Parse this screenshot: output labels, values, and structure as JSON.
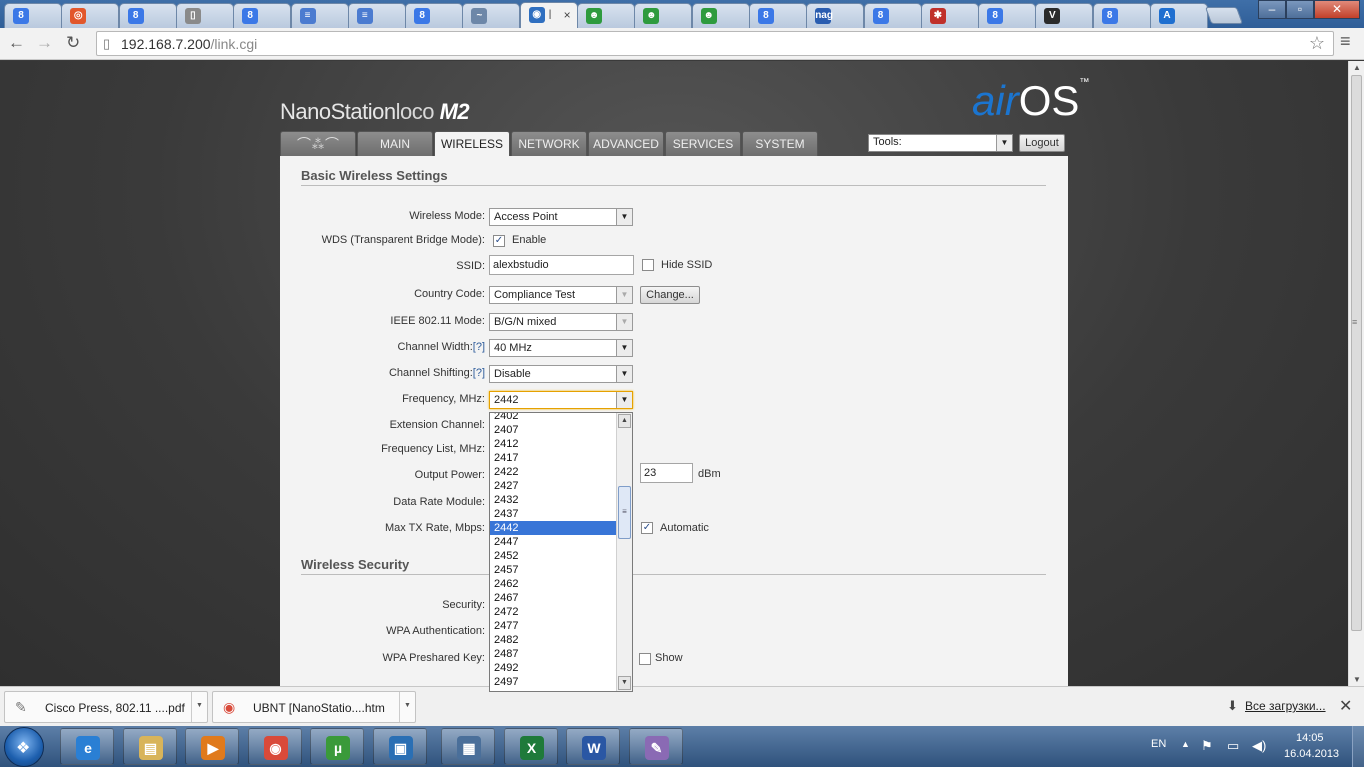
{
  "browser": {
    "tabs": [
      {
        "icon": "google-icon",
        "text": "8",
        "title": "",
        "color": "#3b78e7"
      },
      {
        "icon": "ubuntu-icon",
        "text": "◎",
        "title": "",
        "color": "#e2572b"
      },
      {
        "icon": "google-icon",
        "text": "8",
        "title": "",
        "color": "#3b78e7"
      },
      {
        "icon": "page-icon",
        "text": "▯",
        "title": "",
        "color": "#8a8a8a"
      },
      {
        "icon": "google-icon",
        "text": "8",
        "title": "",
        "color": "#3b78e7"
      },
      {
        "icon": "doc-icon",
        "text": "≡",
        "title": "",
        "color": "#4b7bd0"
      },
      {
        "icon": "doc-icon",
        "text": "≡",
        "title": "",
        "color": "#4b7bd0"
      },
      {
        "icon": "google-icon",
        "text": "8",
        "title": "",
        "color": "#3b78e7"
      },
      {
        "icon": "chart-icon",
        "text": "~",
        "title": "",
        "color": "#6d87a8"
      },
      {
        "icon": "rss-icon",
        "text": "◉",
        "title": "|",
        "color": "#2f6fc0"
      },
      {
        "icon": "frog-icon",
        "text": "☻",
        "title": "",
        "color": "#2e9b3e"
      },
      {
        "icon": "frog-icon",
        "text": "☻",
        "title": "",
        "color": "#2e9b3e"
      },
      {
        "icon": "frog-icon",
        "text": "☻",
        "title": "",
        "color": "#2e9b3e"
      },
      {
        "icon": "google-icon",
        "text": "8",
        "title": "",
        "color": "#3b78e7"
      },
      {
        "icon": "nag-icon",
        "text": "nag",
        "title": "",
        "color": "#2a5db0"
      },
      {
        "icon": "google-icon",
        "text": "8",
        "title": "",
        "color": "#3b78e7"
      },
      {
        "icon": "bug-icon",
        "text": "✱",
        "title": "",
        "color": "#c0302a"
      },
      {
        "icon": "google-icon",
        "text": "8",
        "title": "",
        "color": "#3b78e7"
      },
      {
        "icon": "v-icon",
        "text": "V",
        "title": "",
        "color": "#2b2b2b"
      },
      {
        "icon": "google-icon",
        "text": "8",
        "title": "",
        "color": "#3b78e7"
      },
      {
        "icon": "a-icon",
        "text": "A",
        "title": "",
        "color": "#1f6fd0"
      }
    ],
    "active_tab_close": "×",
    "url_host": "192.168.7.200",
    "url_path": "/link.cgi"
  },
  "page": {
    "brand_model": "NanoStation",
    "brand_loco": "loco",
    "brand_m2": "M2",
    "brand_air": "air",
    "brand_os": "OS",
    "brand_tm": "™",
    "nav_tabs": [
      "MAIN",
      "WIRELESS",
      "NETWORK",
      "ADVANCED",
      "SERVICES",
      "SYSTEM"
    ],
    "tools_label": "Tools:",
    "logout_label": "Logout",
    "basic_title": "Basic Wireless Settings",
    "fields": {
      "wireless_mode_label": "Wireless Mode:",
      "wireless_mode_value": "Access Point",
      "wds_label": "WDS (Transparent Bridge Mode):",
      "wds_enable_label": "Enable",
      "ssid_label": "SSID:",
      "ssid_value": "alexbstudio",
      "hide_ssid_label": "Hide SSID",
      "country_label": "Country Code:",
      "country_value": "Compliance Test",
      "change_button": "Change...",
      "ieee_label": "IEEE 802.11 Mode:",
      "ieee_value": "B/G/N mixed",
      "channel_width_label": "Channel Width:",
      "channel_width_value": "40 MHz",
      "channel_shift_label": "Channel Shifting:",
      "channel_shift_value": "Disable",
      "help": "[?]",
      "frequency_label": "Frequency, MHz:",
      "frequency_value": "2442",
      "ext_channel_label": "Extension Channel:",
      "freq_list_label": "Frequency List, MHz:",
      "output_power_label": "Output Power:",
      "output_power_value": "23",
      "output_power_unit": "dBm",
      "data_rate_label": "Data Rate Module:",
      "max_tx_label": "Max TX Rate, Mbps:",
      "automatic_label": "Automatic"
    },
    "security_title": "Wireless Security",
    "security_fields": {
      "security_label": "Security:",
      "wpa_auth_label": "WPA Authentication:",
      "wpa_key_label": "WPA Preshared Key:",
      "show_label": "Show"
    },
    "freq_options": [
      "2402",
      "2407",
      "2412",
      "2417",
      "2422",
      "2427",
      "2432",
      "2437",
      "2442",
      "2447",
      "2452",
      "2457",
      "2462",
      "2467",
      "2472",
      "2477",
      "2482",
      "2487",
      "2492",
      "2497"
    ],
    "freq_selected": "2442"
  },
  "downloads": {
    "items": [
      {
        "name": "Cisco Press, 802.11 ....pdf",
        "icon": "pdf-icon"
      },
      {
        "name": "UBNT  [NanoStatio....htm",
        "icon": "chrome-icon"
      }
    ],
    "all_downloads": "Все загрузки..."
  },
  "taskbar": {
    "lang": "EN",
    "time": "14:05",
    "date": "16.04.2013",
    "apps": [
      {
        "name": "taskbar-ie",
        "glyph": "e",
        "color": "#2a7fd4"
      },
      {
        "name": "taskbar-explorer",
        "glyph": "▤",
        "color": "#d8b45a"
      },
      {
        "name": "taskbar-media",
        "glyph": "▶",
        "color": "#e07a1c"
      },
      {
        "name": "taskbar-chrome",
        "glyph": "◉",
        "color": "#d94a3a"
      },
      {
        "name": "taskbar-utorrent",
        "glyph": "µ",
        "color": "#3a9a3a"
      },
      {
        "name": "taskbar-app",
        "glyph": "▣",
        "color": "#2a6fb4"
      },
      {
        "name": "taskbar-network",
        "glyph": "▦",
        "color": "#4a6f9a"
      },
      {
        "name": "taskbar-excel",
        "glyph": "X",
        "color": "#1f7a3a"
      },
      {
        "name": "taskbar-word",
        "glyph": "W",
        "color": "#2a57a4"
      },
      {
        "name": "taskbar-paint",
        "glyph": "✎",
        "color": "#8a6ab4"
      }
    ]
  }
}
